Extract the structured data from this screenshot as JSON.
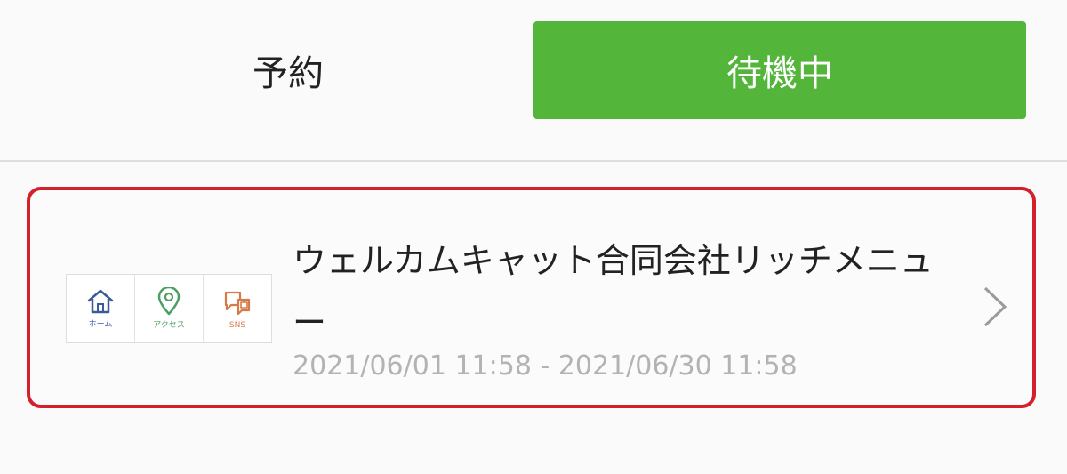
{
  "tabs": {
    "reserve_label": "予約",
    "waiting_label": "待機中",
    "active_color": "#53b63a"
  },
  "card": {
    "title": "ウェルカムキャット合同会社リッチメニュー",
    "date_range": "2021/06/01 11:58 - 2021/06/30 11:58",
    "highlight_color": "#d3202a",
    "thumbnail": {
      "items": [
        {
          "label": "ホーム",
          "icon": "home-icon"
        },
        {
          "label": "アクセス",
          "icon": "map-pin-icon"
        },
        {
          "label": "SNS",
          "icon": "sns-like-icon"
        }
      ]
    }
  }
}
